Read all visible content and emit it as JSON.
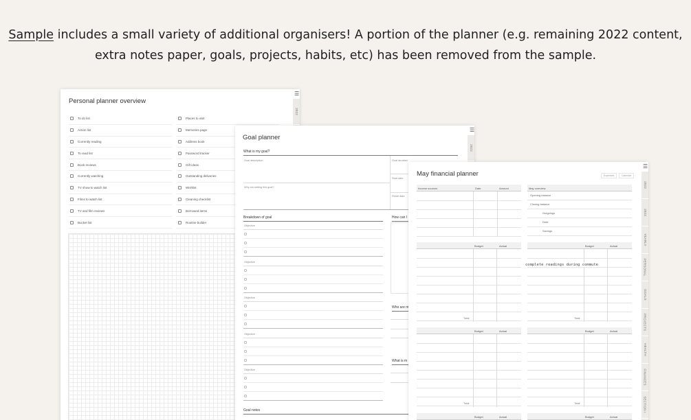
{
  "headline": {
    "link": "Sample",
    "line1_rest": " includes a small variety of additional organisers! A portion of the planner (e.g. remaining 2022 content,",
    "line2": "extra notes paper, goals, projects, habits, etc) has been removed from the sample."
  },
  "page1": {
    "title": "Personal planner overview",
    "tab": "2022",
    "left_list": [
      "To do list",
      "Action list",
      "Currently reading",
      "To read list",
      "Book reviews",
      "Currently watching",
      "TV show to watch list",
      "Films to watch list",
      "TV and film reviews",
      "Bucket list"
    ],
    "right_list": [
      "Places to visit",
      "Memories page",
      "Address book",
      "Password tracker",
      "Gift ideas",
      "Outstanding deliveries",
      "Wishlist",
      "Cleaning checklist",
      "Borrowed items",
      "Routine builder"
    ]
  },
  "page2": {
    "title": "Goal planner",
    "tab": "2022",
    "what_is_my_goal": "What is my goal?",
    "goal_description": "Goal description",
    "goal_duration": "Goal duration",
    "why_setting": "Why am setting this goal?",
    "start_date": "Start date",
    "finish_date": "Finish date",
    "breakdown": "Breakdown of goal",
    "how_can": "How can I",
    "objective": "Objective",
    "who_are": "Who are m",
    "what_is": "What is m",
    "goal_notes": "Goal notes"
  },
  "page3": {
    "title": "May financial planner",
    "pills": [
      "Expenses",
      "Calendar"
    ],
    "income_sources": "Income sources",
    "date": "Date",
    "amount": "Amount",
    "may_overview": "May overview",
    "overview_items": [
      "Opening balance",
      "Closing balance",
      "Outgoings",
      "Debt",
      "Savings"
    ],
    "budget": "Budget",
    "actual": "Actual",
    "total": "Total",
    "note": "complete readings during commute",
    "tabs": [
      "2022",
      "2023",
      "YEARLY",
      "PERSONAL",
      "GOALS",
      "PROJECTS",
      "HEALTH",
      "FINANCES",
      "SECTION I"
    ]
  }
}
